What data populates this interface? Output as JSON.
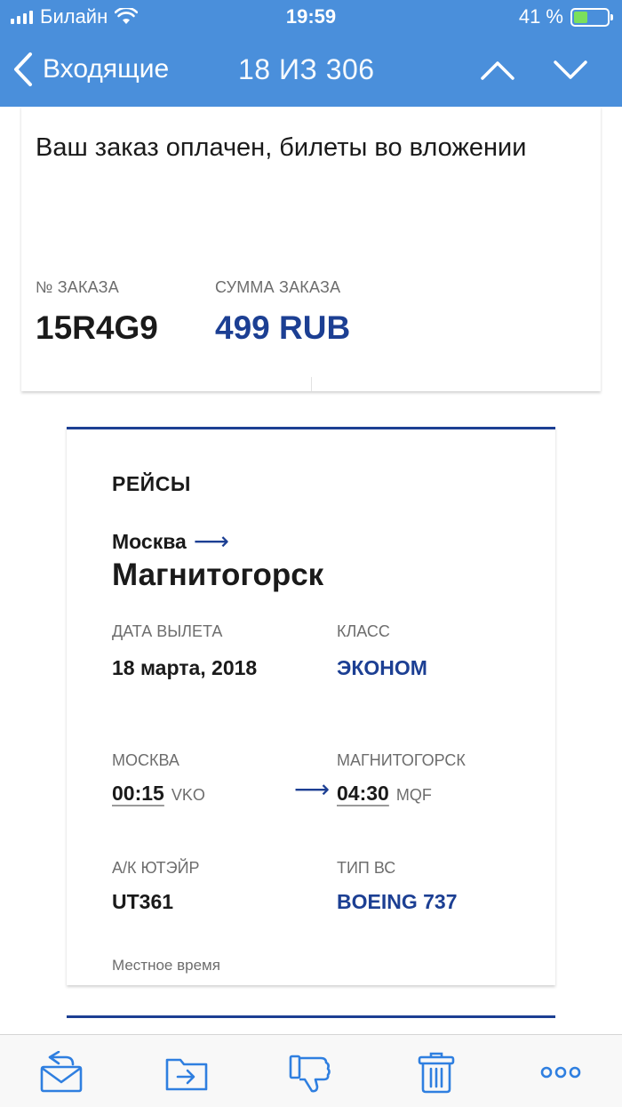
{
  "status": {
    "carrier": "Билайн",
    "time": "19:59",
    "battery": "41 %",
    "battery_level": 0.41,
    "icons": [
      "signal-icon",
      "wifi-icon",
      "battery-icon"
    ]
  },
  "nav": {
    "back_label": "Входящие",
    "counter": "18 ИЗ 306",
    "icons": [
      "chevron-left-icon",
      "chevron-up-icon",
      "chevron-down-icon"
    ]
  },
  "order": {
    "headline": "Ваш заказ оплачен, билеты во вложении",
    "number_label": "№ ЗАКАЗА",
    "number": "15R4G9",
    "sum_label": "СУММА ЗАКАЗА",
    "sum": "499 RUB"
  },
  "flight": {
    "section_title": "РЕЙСЫ",
    "from_city": "Москва",
    "to_city": "Магнитогорск",
    "date_label": "ДАТА ВЫЛЕТА",
    "date": "18 марта, 2018",
    "class_label": "КЛАСС",
    "class": "ЭКОНОМ",
    "dep_city_label": "МОСКВА",
    "dep_time": "00:15",
    "dep_code": "VKO",
    "arr_city_label": "МАГНИТОГОРСК",
    "arr_time": "04:30",
    "arr_code": "MQF",
    "airline_label": "А/К ЮТЭЙР",
    "flight_number": "UT361",
    "aircraft_label": "ТИП ВС",
    "aircraft": "BOEING 737",
    "local_time_note": "Местное время"
  },
  "toolbar": {
    "icons": [
      "reply-icon",
      "move-to-folder-icon",
      "spam-icon",
      "trash-icon",
      "more-icon"
    ]
  },
  "colors": {
    "header_blue": "#4a8fdb",
    "accent_navy": "#1c3f93",
    "toolbar_icon": "#2f7fe0"
  }
}
